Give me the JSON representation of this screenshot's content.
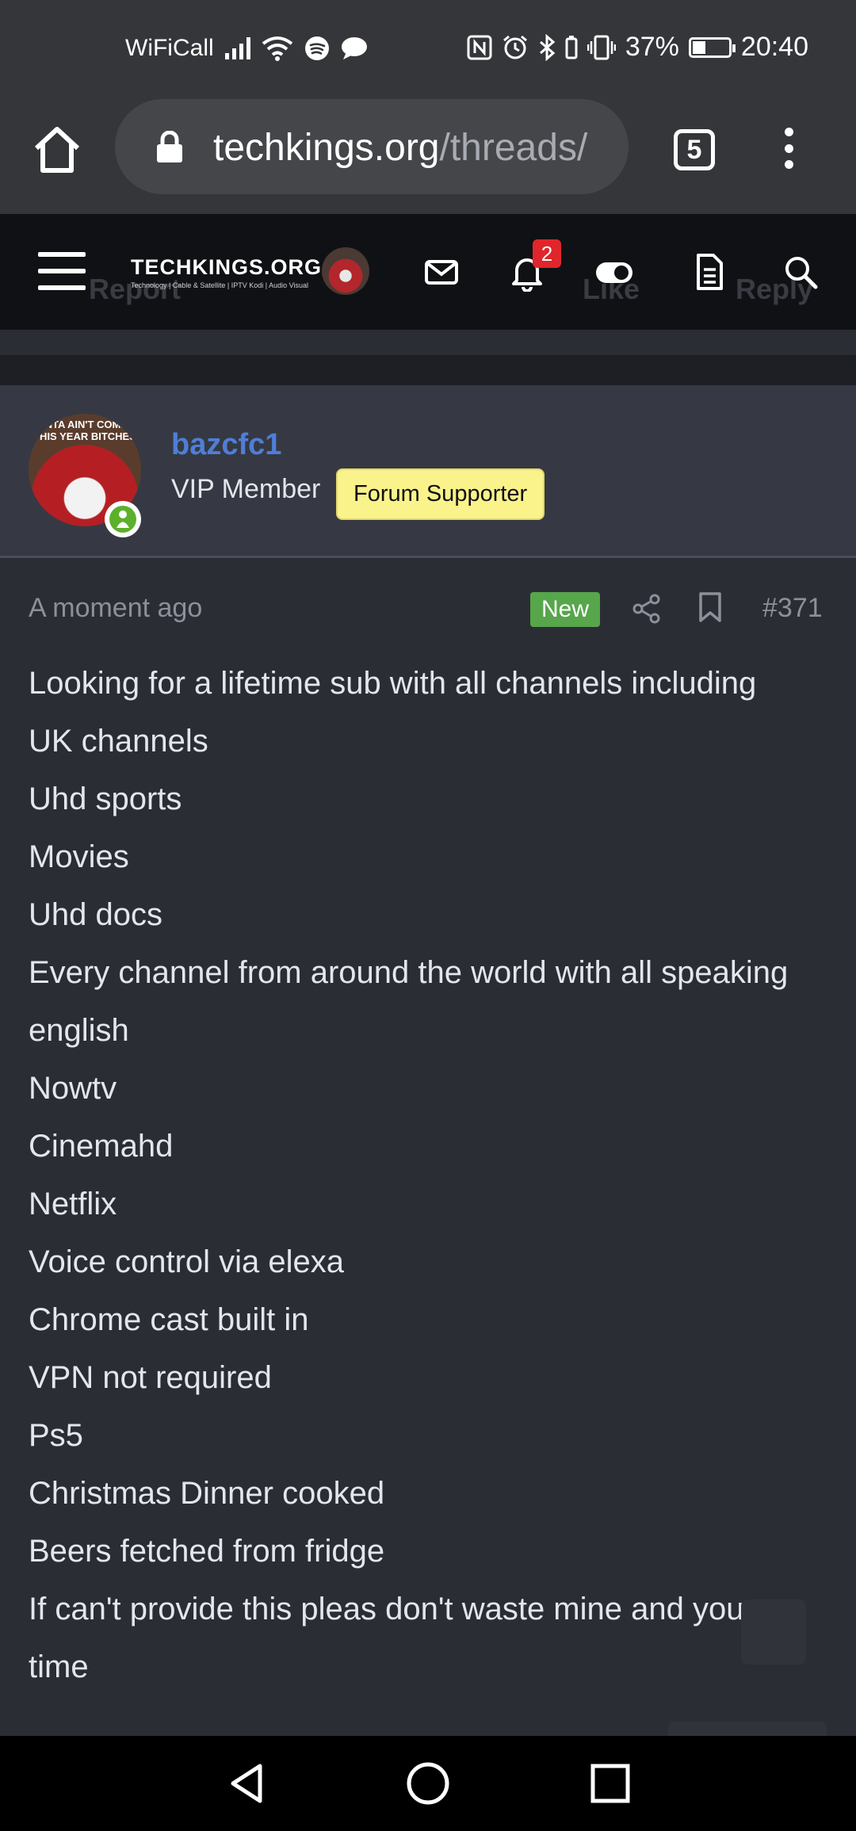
{
  "status_bar": {
    "carrier": "WiFiCall",
    "battery": "37%",
    "time": "20:40"
  },
  "browser": {
    "url_domain": "techkings.org",
    "url_path": "/threads/",
    "tab_count": "5"
  },
  "site_header": {
    "logo_main": "TECHKINGS.ORG",
    "logo_sub": "Technology | Cable & Satellite | IPTV Kodi | Audio Visual",
    "notification_count": "2",
    "behind_actions": {
      "report": "Report",
      "like": "Like",
      "reply": "Reply"
    }
  },
  "post": {
    "avatar_caption": "SANTA AIN'T COMING THIS YEAR BITCHES",
    "username": "bazcfc1",
    "user_title": "VIP Member",
    "badge": "Forum Supporter",
    "time": "A moment ago",
    "new_label": "New",
    "post_number": "#371",
    "body_lines": [
      "Looking for a lifetime sub with all channels including",
      "UK channels",
      "Uhd sports",
      "Movies",
      "Uhd docs",
      "Every channel from around the world with all speaking",
      "english",
      "Nowtv",
      "Cinemahd",
      "Netflix",
      "Voice control via elexa",
      "Chrome cast built in",
      "VPN not required",
      "Ps5",
      "Christmas Dinner cooked",
      "Beers fetched from fridge",
      "If can't provide this pleas don't waste mine and your",
      "time"
    ]
  },
  "icons": {
    "status": [
      "signal-icon",
      "wifi-icon",
      "spotify-icon",
      "chat-bubble-icon",
      "nfc-icon",
      "alarm-icon",
      "bluetooth-icon",
      "vibrate-icon",
      "battery-icon"
    ],
    "browser": [
      "home-icon",
      "lock-icon",
      "tabs-icon",
      "more-icon"
    ],
    "header": [
      "menu-icon",
      "mail-icon",
      "bell-icon",
      "toggle-icon",
      "document-icon",
      "search-icon"
    ],
    "post": [
      "share-icon",
      "bookmark-icon"
    ],
    "nav": [
      "back-icon",
      "home-circle-icon",
      "recents-icon"
    ]
  },
  "colors": {
    "username": "#4f7ed8",
    "new_badge": "#57a64b",
    "supporter_badge": "#faf28b",
    "notification": "#e0262c",
    "online": "#5cb02c"
  }
}
